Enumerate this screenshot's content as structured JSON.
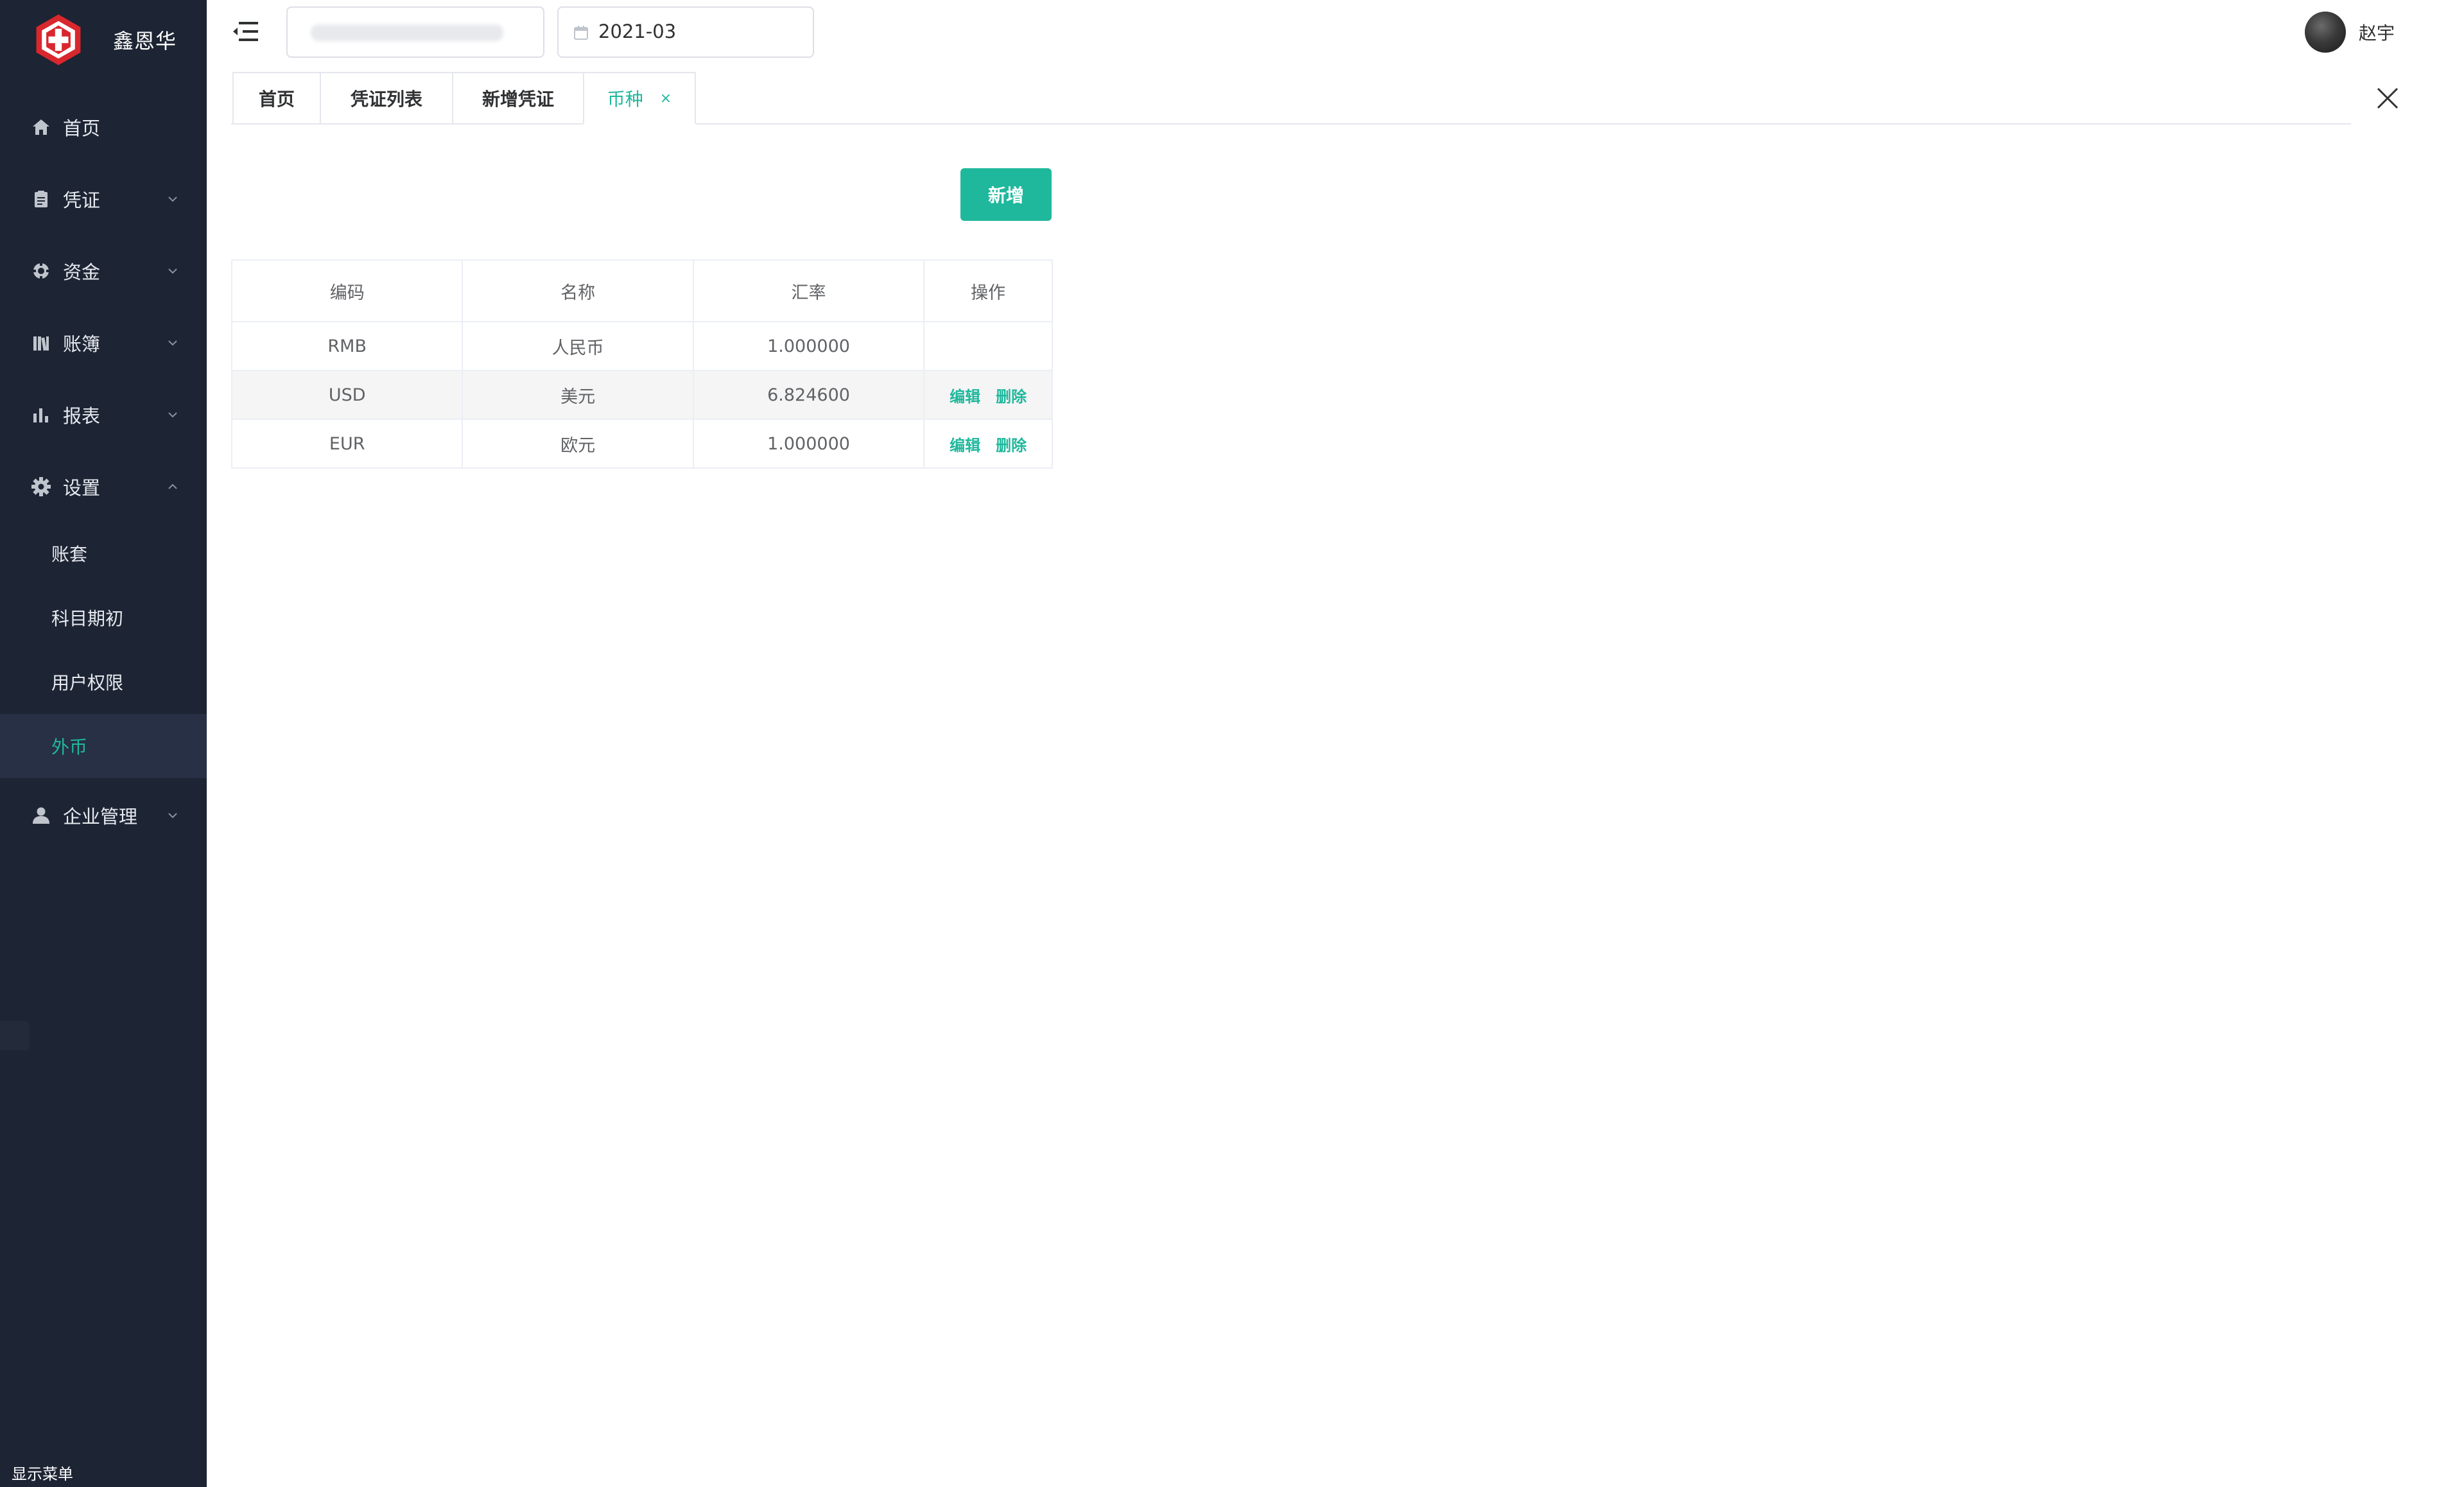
{
  "brand": {
    "name": "鑫恩华"
  },
  "sidebar": {
    "items": [
      {
        "label": "首页",
        "icon": "home-icon"
      },
      {
        "label": "凭证",
        "icon": "voucher-icon"
      },
      {
        "label": "资金",
        "icon": "fund-icon"
      },
      {
        "label": "账簿",
        "icon": "ledger-icon"
      },
      {
        "label": "报表",
        "icon": "report-icon"
      },
      {
        "label": "设置",
        "icon": "gear-icon"
      },
      {
        "label": "企业管理",
        "icon": "user-icon"
      }
    ],
    "settings_children": [
      {
        "label": "账套"
      },
      {
        "label": "科目期初"
      },
      {
        "label": "用户权限"
      },
      {
        "label": "外币",
        "active": true
      }
    ],
    "show_menu_label": "显示菜单"
  },
  "topbar": {
    "period": "2021-03",
    "username": "赵宇"
  },
  "tabs": [
    {
      "label": "首页"
    },
    {
      "label": "凭证列表"
    },
    {
      "label": "新增凭证"
    },
    {
      "label": "币种",
      "active": true,
      "close": "×"
    }
  ],
  "toolbar": {
    "add_label": "新增"
  },
  "table": {
    "headers": [
      "编码",
      "名称",
      "汇率",
      "操作"
    ],
    "rows": [
      {
        "code": "RMB",
        "name": "人民币",
        "rate": "1.000000"
      },
      {
        "code": "USD",
        "name": "美元",
        "rate": "6.824600",
        "edit": "编辑",
        "delete": "删除"
      },
      {
        "code": "EUR",
        "name": "欧元",
        "rate": "1.000000",
        "edit": "编辑",
        "delete": "删除"
      }
    ]
  },
  "colors": {
    "sidebar_bg": "#1d2433",
    "accent": "#1fb89c",
    "logo_red": "#d9272e"
  }
}
